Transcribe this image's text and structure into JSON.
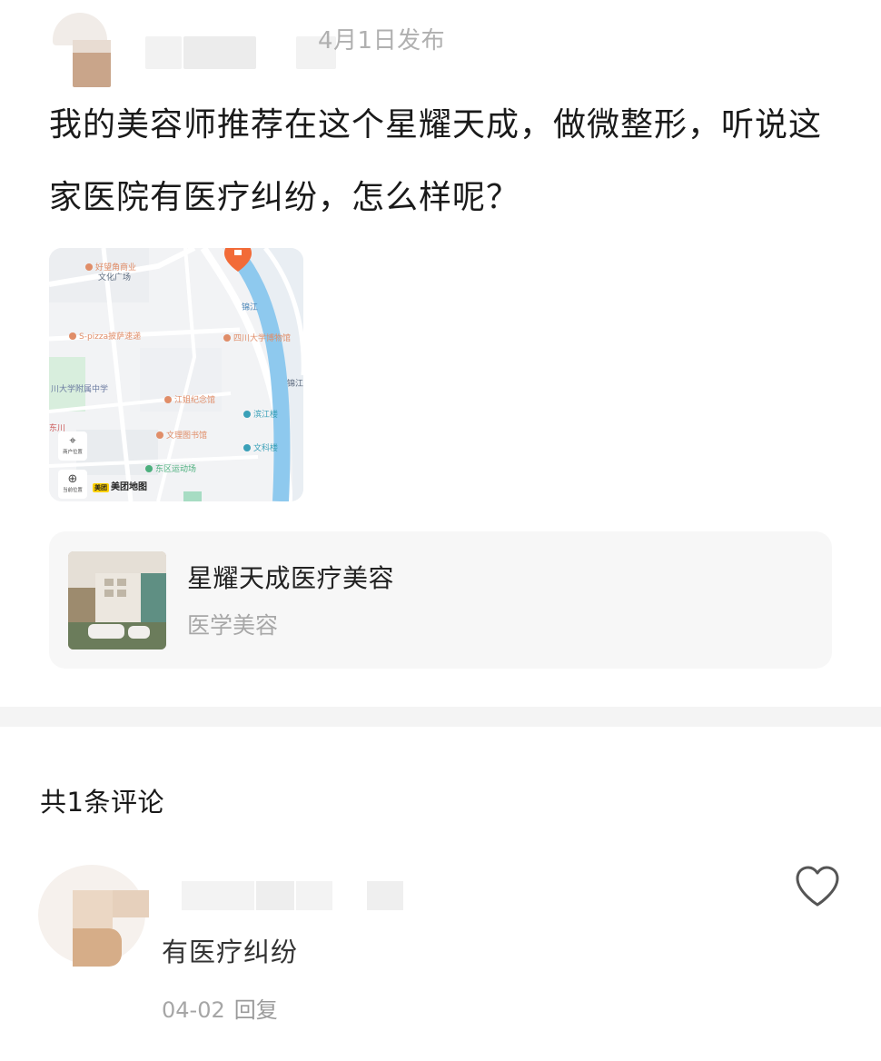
{
  "post": {
    "date_text": "4月1日发布",
    "content": "我的美容师推荐在这个星耀天成，做微整形，听说这家医院有医疗纠纷，怎么样呢？"
  },
  "map": {
    "brand": "美团地图",
    "brand_badge": "美团",
    "controls": [
      {
        "icon": "location-pin-icon",
        "label": "商户位置"
      },
      {
        "icon": "crosshair-icon",
        "label": "当前位置"
      }
    ],
    "labels": [
      "好望角商业",
      "文化广场",
      "S-pizza披萨速递",
      "四川大学博物馆",
      "川大学附属中学",
      "江姐纪念馆",
      "滨江楼",
      "文理图书馆",
      "文科楼",
      "东区运动场",
      "锦江",
      "锦江路",
      "东川"
    ],
    "colors": {
      "river": "#8ec9ee",
      "pin": "#f26b38"
    }
  },
  "shop": {
    "name": "星耀天成医疗美容",
    "category": "医学美容"
  },
  "comments": {
    "title": "共1条评论",
    "items": [
      {
        "text": "有医疗纠纷",
        "date": "04-02",
        "reply_label": "回复"
      }
    ]
  },
  "icons": {
    "like": "heart-outline-icon"
  }
}
